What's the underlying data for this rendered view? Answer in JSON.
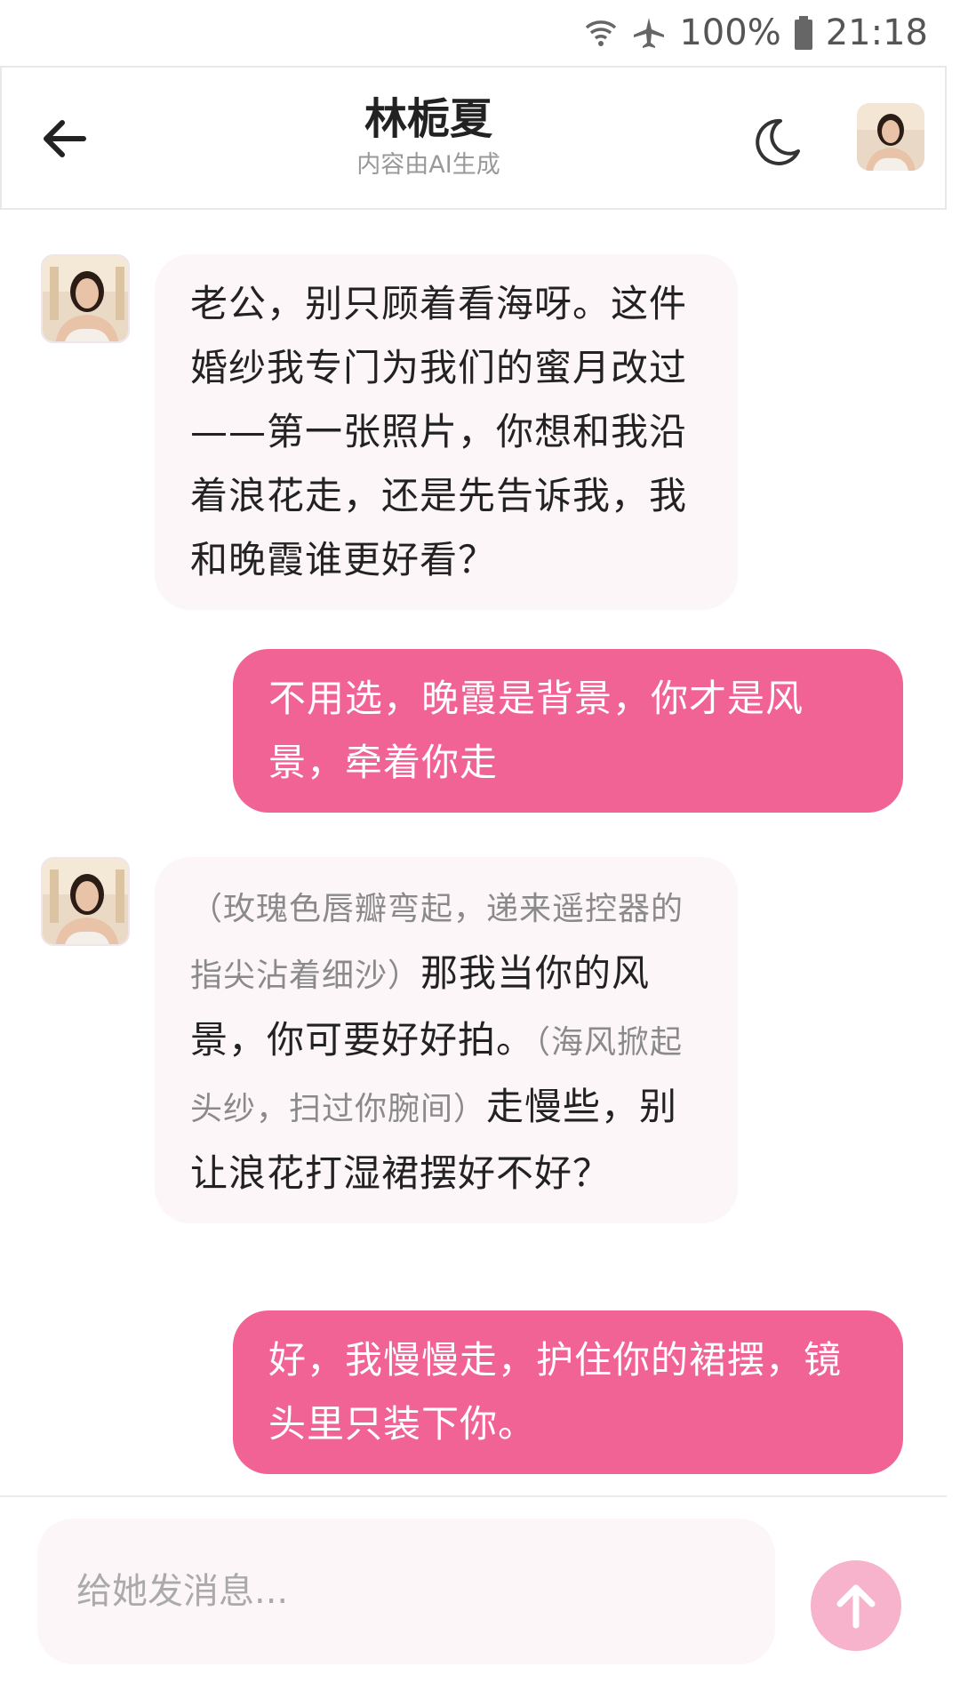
{
  "status_bar": {
    "battery": "100%",
    "time": "21:18"
  },
  "header": {
    "title": "林栀夏",
    "subtitle": "内容由AI生成"
  },
  "messages": [
    {
      "sender": "ai",
      "text": "老公，别只顾着看海呀。这件婚纱我专门为我们的蜜月改过——第一张照片，你想和我沿着浪花走，还是先告诉我，我和晚霞谁更好看？"
    },
    {
      "sender": "me",
      "text": "不用选，晚霞是背景，你才是风景，牵着你走"
    },
    {
      "sender": "ai",
      "action_1": "（玫瑰色唇瓣弯起，递来遥控器的指尖沾着细沙）",
      "text_1": "那我当你的风景，你可要好好拍。",
      "action_2": "（海风掀起头纱，扫过你腕间）",
      "text_2": "走慢些，别让浪花打湿裙摆好不好？"
    },
    {
      "sender": "me",
      "text": "好，我慢慢走，护住你的裙摆，镜头里只装下你。"
    }
  ],
  "composer": {
    "placeholder": "给她发消息..."
  },
  "colors": {
    "accent": "#f06394",
    "send_button": "#f7b3cb",
    "ai_bubble": "#fdf6f8"
  },
  "icons": {
    "back": "arrow-left-icon",
    "theme": "moon-icon",
    "send": "arrow-up-icon",
    "wifi": "wifi-icon",
    "airplane": "airplane-icon",
    "battery": "battery-icon"
  }
}
